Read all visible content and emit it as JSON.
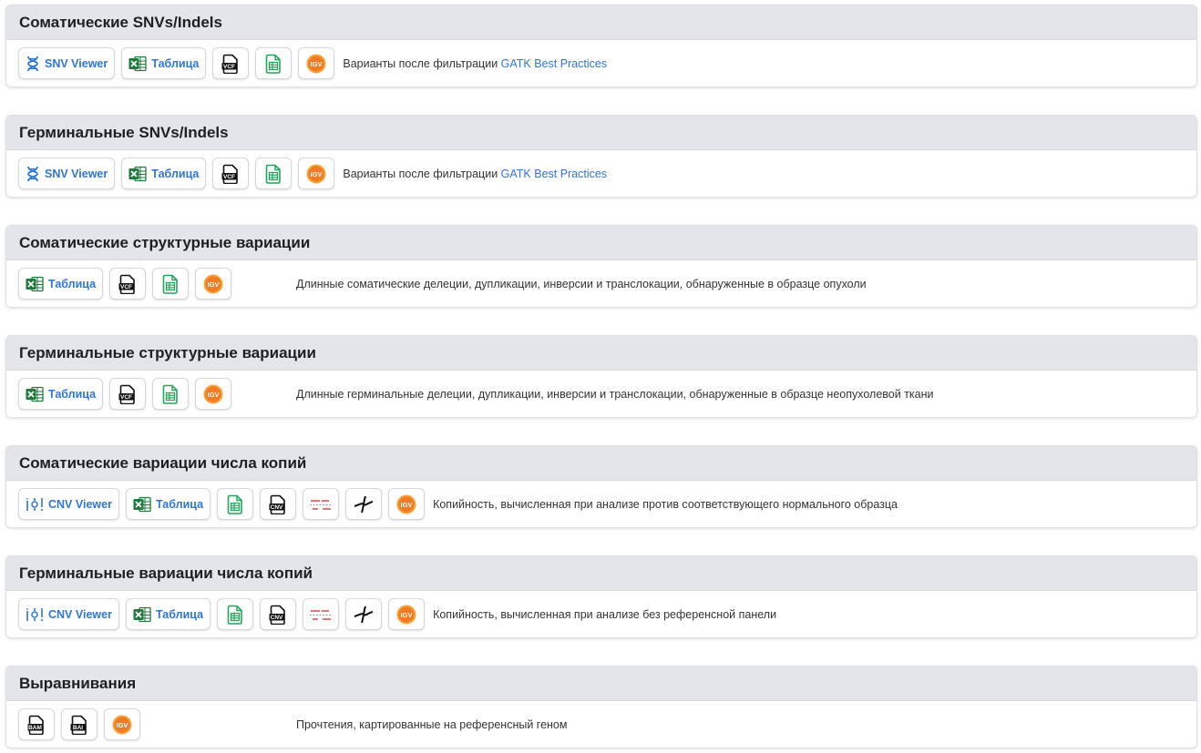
{
  "labels": {
    "snv_viewer": "SNV Viewer",
    "cnv_viewer": "CNV Viewer",
    "table": "Таблица",
    "file_vcf": "VCF",
    "file_cnv": "CNV",
    "file_bam": "BAM",
    "file_bai": "BAI",
    "igv": "IGV"
  },
  "icons": {
    "snv_viewer": "dna-icon",
    "cnv_viewer": "cnv-bars-icon",
    "table": "excel-icon",
    "vcf": "vcf-file-icon",
    "cnv": "cnv-file-icon",
    "bam": "bam-file-icon",
    "bai": "bai-file-icon",
    "sheet": "spreadsheet-icon",
    "segments": "segments-icon",
    "plot": "scatter-plot-icon",
    "igv": "igv-icon"
  },
  "colors": {
    "accent": "#2f76d2",
    "excel_green": "#1f7a3c",
    "sheet_green": "#25a35a",
    "igv_orange": "#f07b22",
    "header_bg": "#e3e5ea"
  },
  "sections": [
    {
      "title": "Соматические SNVs/Indels",
      "desc": "Варианты после фильтрации ",
      "link": "GATK Best Practices"
    },
    {
      "title": "Герминальные SNVs/Indels",
      "desc": "Варианты после фильтрации ",
      "link": "GATK Best Practices"
    },
    {
      "title": "Соматические структурные вариации",
      "desc": "Длинные соматические делеции, дупликации, инверсии и транслокации, обнаруженные в образце опухоли"
    },
    {
      "title": "Герминальные структурные вариации",
      "desc": "Длинные герминальные делеции, дупликации, инверсии и транслокации, обнаруженные в образце неопухолевой ткани"
    },
    {
      "title": "Соматические вариации числа копий",
      "desc": "Копийность, вычисленная при анализе против соответствующего нормального образца"
    },
    {
      "title": "Герминальные вариации числа копий",
      "desc": "Копийность, вычисленная при анализе без референсной панели"
    },
    {
      "title": "Выравнивания",
      "desc": "Прочтения, картированные на референсный геном"
    }
  ]
}
